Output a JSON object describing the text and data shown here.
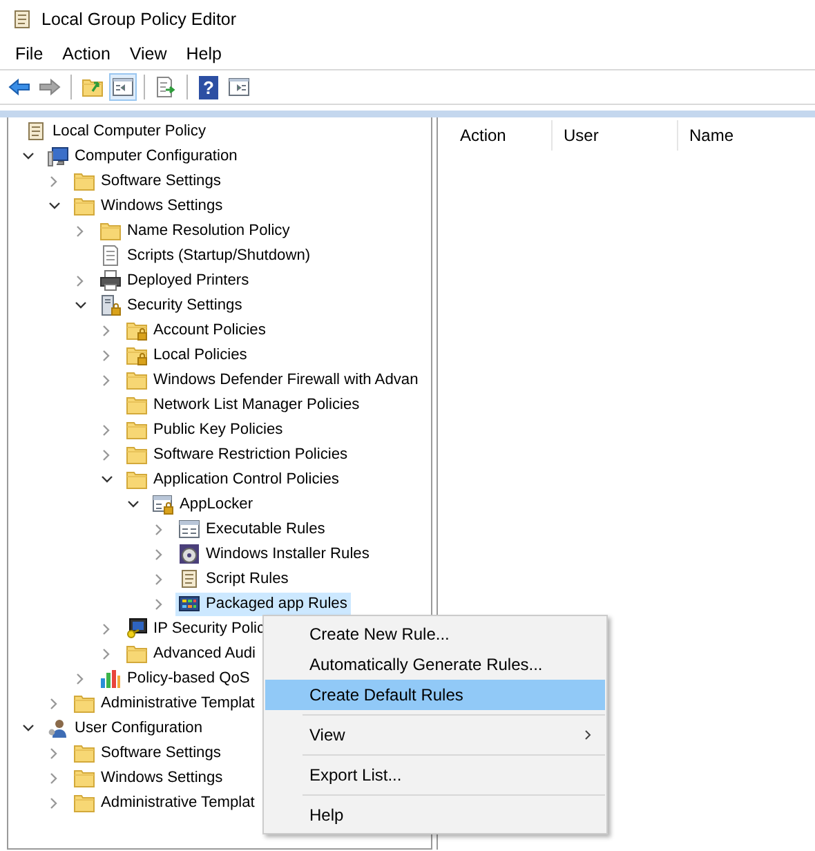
{
  "window": {
    "title": "Local Group Policy Editor"
  },
  "menu_bar": [
    "File",
    "Action",
    "View",
    "Help"
  ],
  "toolbar": [
    {
      "kind": "back",
      "disabled": false,
      "pressed": false
    },
    {
      "kind": "forward",
      "disabled": true,
      "pressed": false
    },
    {
      "kind": "separator"
    },
    {
      "kind": "up",
      "disabled": false,
      "pressed": false
    },
    {
      "kind": "tree-toggle",
      "disabled": false,
      "pressed": true
    },
    {
      "kind": "separator"
    },
    {
      "kind": "export",
      "disabled": false,
      "pressed": false
    },
    {
      "kind": "separator"
    },
    {
      "kind": "help",
      "glyph": "?",
      "disabled": false,
      "pressed": false
    },
    {
      "kind": "pane-toggle",
      "disabled": false,
      "pressed": false
    }
  ],
  "tree": {
    "label": "Local Computer Policy",
    "kind": "scroll",
    "selected": false,
    "children": [
      {
        "label": "Computer Configuration",
        "kind": "computer",
        "expanded": true,
        "selected": false,
        "children": [
          {
            "label": "Software Settings",
            "kind": "folder",
            "expanded": false,
            "selected": false
          },
          {
            "label": "Windows Settings",
            "kind": "folder",
            "expanded": true,
            "selected": false,
            "children": [
              {
                "label": "Name Resolution Policy",
                "kind": "folder",
                "expanded": false,
                "selected": false
              },
              {
                "label": "Scripts (Startup/Shutdown)",
                "kind": "scripts",
                "selected": false
              },
              {
                "label": "Deployed Printers",
                "kind": "printer",
                "expanded": false,
                "selected": false
              },
              {
                "label": "Security Settings",
                "kind": "server-lock",
                "expanded": true,
                "selected": false,
                "children": [
                  {
                    "label": "Account Policies",
                    "kind": "folder-lock",
                    "expanded": false,
                    "selected": false
                  },
                  {
                    "label": "Local Policies",
                    "kind": "folder-lock",
                    "expanded": false,
                    "selected": false
                  },
                  {
                    "label": "Windows Defender Firewall with Advan",
                    "kind": "folder",
                    "expanded": false,
                    "selected": false
                  },
                  {
                    "label": "Network List Manager Policies",
                    "kind": "folder",
                    "selected": false
                  },
                  {
                    "label": "Public Key Policies",
                    "kind": "folder",
                    "expanded": false,
                    "selected": false
                  },
                  {
                    "label": "Software Restriction Policies",
                    "kind": "folder",
                    "expanded": false,
                    "selected": false
                  },
                  {
                    "label": "Application Control Policies",
                    "kind": "folder",
                    "expanded": true,
                    "selected": false,
                    "children": [
                      {
                        "label": "AppLocker",
                        "kind": "window-lock",
                        "expanded": true,
                        "selected": false,
                        "children": [
                          {
                            "label": "Executable Rules",
                            "kind": "window",
                            "expanded": false,
                            "selected": false
                          },
                          {
                            "label": "Windows Installer Rules",
                            "kind": "disc",
                            "expanded": false,
                            "selected": false
                          },
                          {
                            "label": "Script Rules",
                            "kind": "scroll",
                            "expanded": false,
                            "selected": false
                          },
                          {
                            "label": "Packaged app Rules",
                            "kind": "tiles",
                            "expanded": false,
                            "selected": true
                          }
                        ]
                      }
                    ]
                  },
                  {
                    "label": "IP Security Polic",
                    "kind": "ip",
                    "expanded": false,
                    "selected": false
                  },
                  {
                    "label": "Advanced Audi",
                    "kind": "folder",
                    "expanded": false,
                    "selected": false
                  }
                ]
              },
              {
                "label": "Policy-based QoS",
                "kind": "chart",
                "expanded": false,
                "selected": false
              }
            ]
          },
          {
            "label": "Administrative Templat",
            "kind": "folder",
            "expanded": false,
            "selected": false
          }
        ]
      },
      {
        "label": "User Configuration",
        "kind": "user",
        "expanded": true,
        "selected": false,
        "children": [
          {
            "label": "Software Settings",
            "kind": "folder",
            "expanded": false,
            "selected": false
          },
          {
            "label": "Windows Settings",
            "kind": "folder",
            "expanded": false,
            "selected": false
          },
          {
            "label": "Administrative Templat",
            "kind": "folder",
            "expanded": false,
            "selected": false
          }
        ]
      }
    ]
  },
  "columns": [
    "Action",
    "User",
    "Name"
  ],
  "context_menu": [
    {
      "kind": "item",
      "label": "Create New Rule...",
      "selected": false
    },
    {
      "kind": "item",
      "label": "Automatically Generate Rules...",
      "selected": false
    },
    {
      "kind": "item",
      "label": "Create Default Rules",
      "selected": true
    },
    {
      "kind": "separator"
    },
    {
      "kind": "item",
      "label": "View",
      "selected": false,
      "submenu": true
    },
    {
      "kind": "separator"
    },
    {
      "kind": "item",
      "label": "Export List...",
      "selected": false
    },
    {
      "kind": "separator"
    },
    {
      "kind": "item",
      "label": "Help",
      "selected": false
    }
  ]
}
